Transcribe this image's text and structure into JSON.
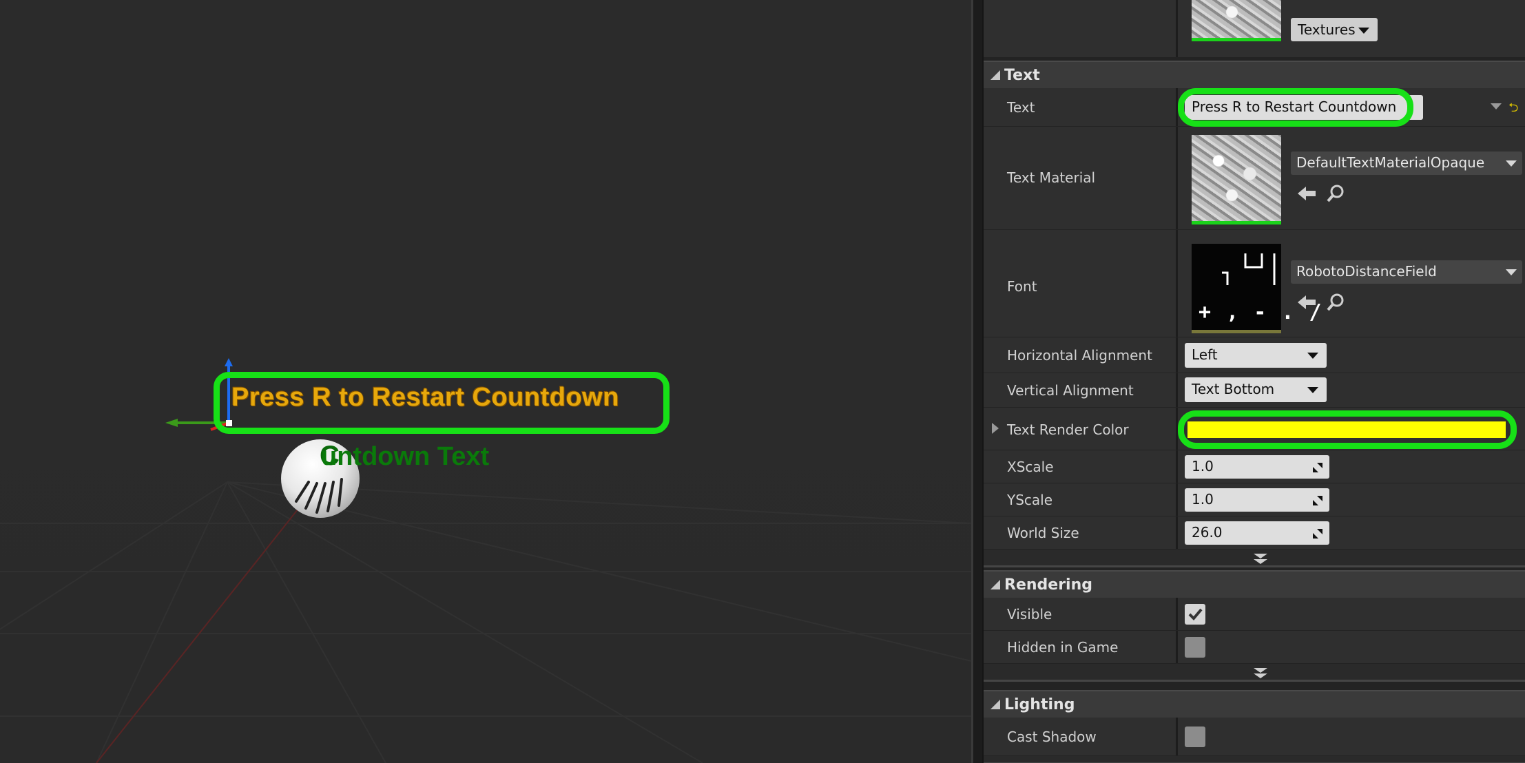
{
  "viewport": {
    "text_render_text": "Press R to Restart Countdown",
    "label_text": "untdown Text",
    "sphere_glyph": "C"
  },
  "details": {
    "top_asset": {
      "dropdown_label": "Textures"
    },
    "text_category": {
      "title": "Text",
      "text_row": {
        "label": "Text",
        "value": "Press R to Restart Countdown"
      },
      "text_material_row": {
        "label": "Text Material",
        "asset": "DefaultTextMaterialOpaque"
      },
      "font_row": {
        "label": "Font",
        "asset": "RobotoDistanceField",
        "thumb_glyphs": "+ , - . /"
      },
      "horizontal_alignment": {
        "label": "Horizontal Alignment",
        "value": "Left"
      },
      "vertical_alignment": {
        "label": "Vertical Alignment",
        "value": "Text Bottom"
      },
      "text_render_color": {
        "label": "Text Render Color",
        "color": "#ffff00"
      },
      "xscale": {
        "label": "XScale",
        "value": "1.0"
      },
      "yscale": {
        "label": "YScale",
        "value": "1.0"
      },
      "world_size": {
        "label": "World Size",
        "value": "26.0"
      }
    },
    "rendering_category": {
      "title": "Rendering",
      "visible": {
        "label": "Visible",
        "checked": true
      },
      "hidden_in_game": {
        "label": "Hidden in Game",
        "checked": false
      }
    },
    "lighting_category": {
      "title": "Lighting",
      "cast_shadow": {
        "label": "Cast Shadow",
        "checked": false
      }
    }
  },
  "colors": {
    "highlight": "#17e017",
    "text_orange": "#e7a80c",
    "label_green": "#0a7a0a",
    "yellow": "#ffff00"
  }
}
